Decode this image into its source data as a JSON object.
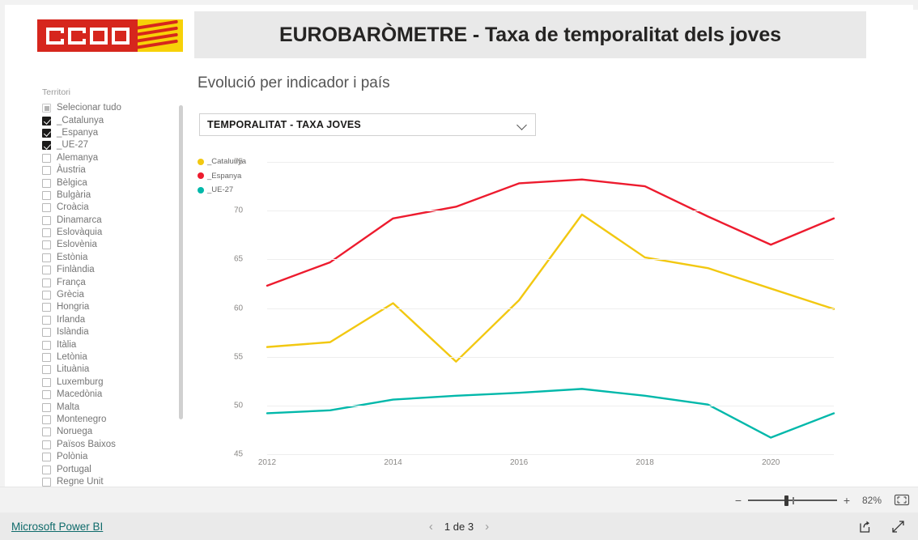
{
  "header": {
    "title": "EUROBARÒMETRE - Taxa de temporalitat dels joves",
    "logo_text": "ccoo"
  },
  "slicer": {
    "title": "Territori",
    "items": [
      {
        "label": "Selecionar tudo",
        "state": "partial"
      },
      {
        "label": "_Catalunya",
        "state": "checked"
      },
      {
        "label": "_Espanya",
        "state": "checked"
      },
      {
        "label": "_UE-27",
        "state": "checked"
      },
      {
        "label": "Alemanya",
        "state": "unchecked"
      },
      {
        "label": "Àustria",
        "state": "unchecked"
      },
      {
        "label": "Bèlgica",
        "state": "unchecked"
      },
      {
        "label": "Bulgària",
        "state": "unchecked"
      },
      {
        "label": "Croàcia",
        "state": "unchecked"
      },
      {
        "label": "Dinamarca",
        "state": "unchecked"
      },
      {
        "label": "Eslovàquia",
        "state": "unchecked"
      },
      {
        "label": "Eslovènia",
        "state": "unchecked"
      },
      {
        "label": "Estònia",
        "state": "unchecked"
      },
      {
        "label": "Finlàndia",
        "state": "unchecked"
      },
      {
        "label": "França",
        "state": "unchecked"
      },
      {
        "label": "Grècia",
        "state": "unchecked"
      },
      {
        "label": "Hongria",
        "state": "unchecked"
      },
      {
        "label": "Irlanda",
        "state": "unchecked"
      },
      {
        "label": "Islàndia",
        "state": "unchecked"
      },
      {
        "label": "Itàlia",
        "state": "unchecked"
      },
      {
        "label": "Letònia",
        "state": "unchecked"
      },
      {
        "label": "Lituània",
        "state": "unchecked"
      },
      {
        "label": "Luxemburg",
        "state": "unchecked"
      },
      {
        "label": "Macedònia",
        "state": "unchecked"
      },
      {
        "label": "Malta",
        "state": "unchecked"
      },
      {
        "label": "Montenegro",
        "state": "unchecked"
      },
      {
        "label": "Noruega",
        "state": "unchecked"
      },
      {
        "label": "Països Baixos",
        "state": "unchecked"
      },
      {
        "label": "Polònia",
        "state": "unchecked"
      },
      {
        "label": "Portugal",
        "state": "unchecked"
      },
      {
        "label": "Regne Unit",
        "state": "unchecked"
      }
    ]
  },
  "visual": {
    "subtitle": "Evolució per indicador i país",
    "dropdown_value": "TEMPORALITAT - TAXA JOVES"
  },
  "chart_data": {
    "type": "line",
    "title": "Evolució per indicador i país",
    "xlabel": "",
    "ylabel": "",
    "x": [
      2012,
      2013,
      2014,
      2015,
      2016,
      2017,
      2018,
      2019,
      2020,
      2021
    ],
    "tick_labels_x": [
      "2012",
      "2014",
      "2016",
      "2018",
      "2020"
    ],
    "tick_labels_y": [
      "45",
      "50",
      "55",
      "60",
      "65",
      "70",
      "75"
    ],
    "xlim": [
      2012,
      2021
    ],
    "ylim": [
      45,
      75
    ],
    "grid": true,
    "legend_position": "left",
    "series": [
      {
        "name": "_Catalunya",
        "color": "#f2c811",
        "values": [
          56.0,
          56.5,
          60.5,
          54.5,
          60.8,
          69.6,
          65.2,
          64.1,
          62.0,
          59.9
        ]
      },
      {
        "name": "_Espanya",
        "color": "#ed1b2e",
        "values": [
          62.3,
          64.7,
          69.2,
          70.4,
          72.8,
          73.2,
          72.5,
          69.4,
          66.5,
          69.2
        ]
      },
      {
        "name": "_UE-27",
        "color": "#01b8aa",
        "values": [
          49.2,
          49.5,
          50.6,
          51.0,
          51.3,
          51.7,
          51.0,
          50.1,
          46.7,
          49.2
        ]
      }
    ]
  },
  "statusbar": {
    "zoom_minus": "−",
    "zoom_plus": "+",
    "zoom_percent": "82%"
  },
  "footer": {
    "brand": "Microsoft Power BI",
    "prev": "‹",
    "next": "›",
    "page_label": "1 de 3"
  }
}
